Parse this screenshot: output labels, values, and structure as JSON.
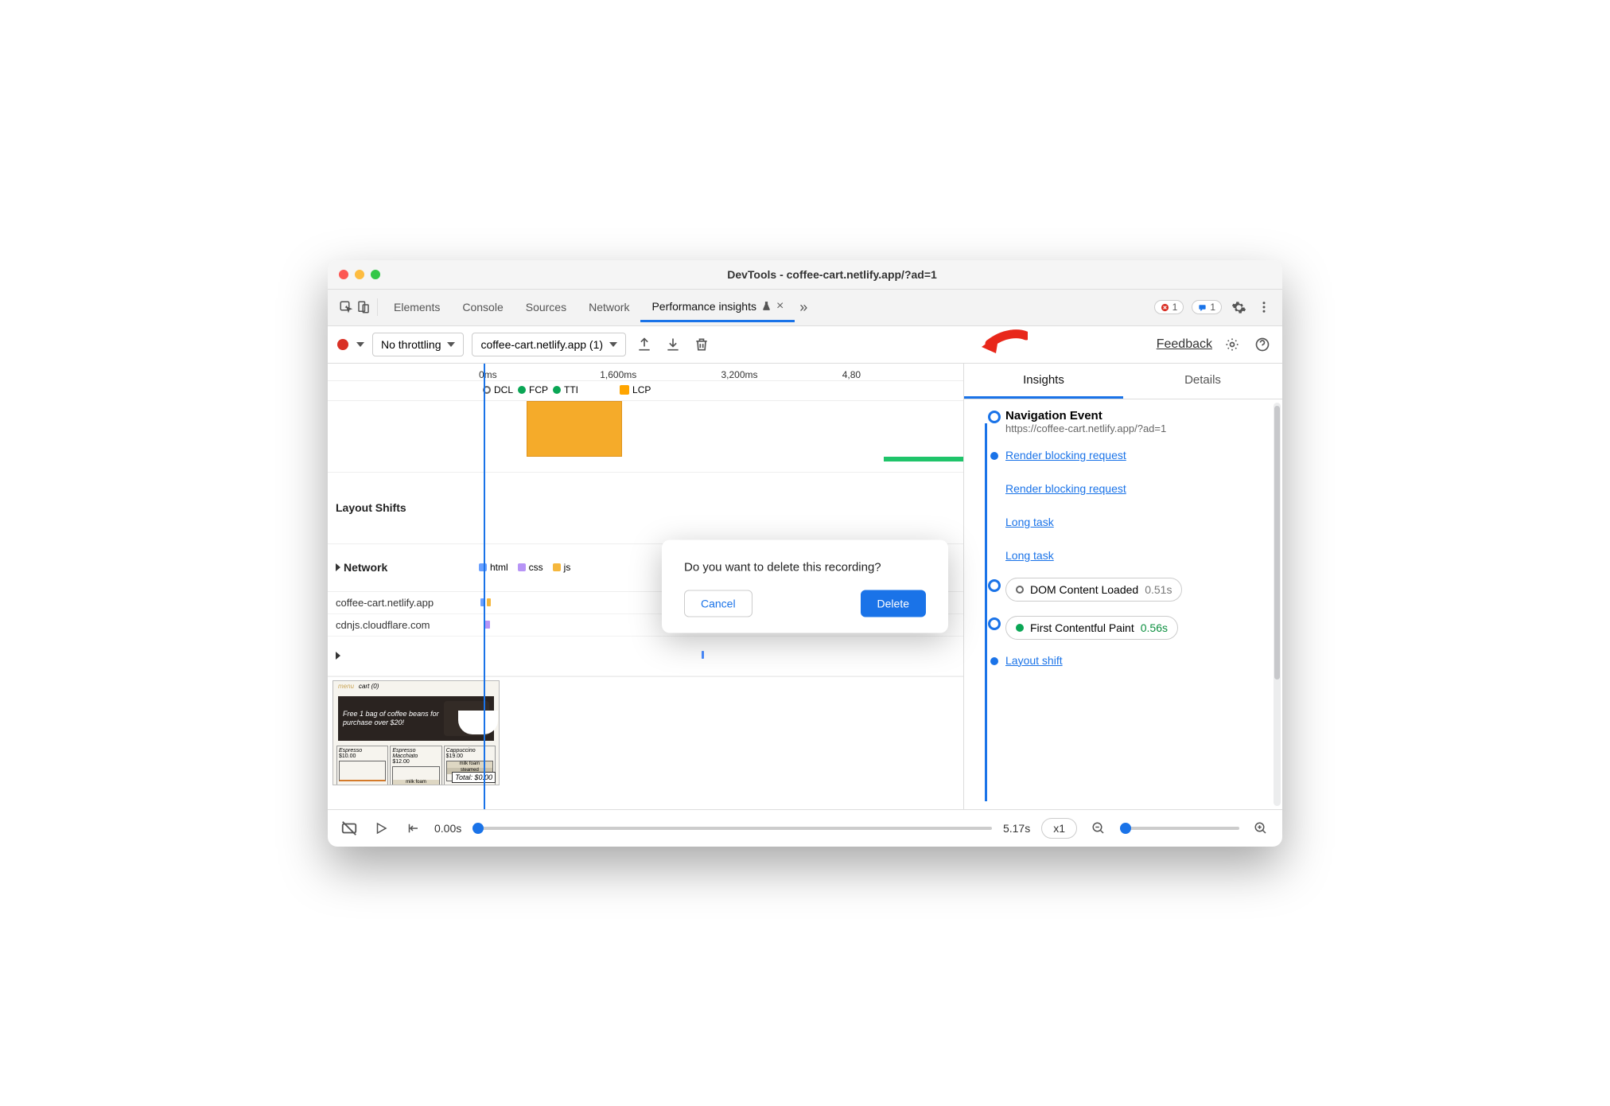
{
  "window": {
    "title": "DevTools - coffee-cart.netlify.app/?ad=1"
  },
  "tabs": {
    "items": [
      "Elements",
      "Console",
      "Sources",
      "Network",
      "Performance insights"
    ],
    "active_index": 4,
    "errors_count": "1",
    "messages_count": "1"
  },
  "toolbar": {
    "throttling": "No throttling",
    "recording_name": "coffee-cart.netlify.app (1)",
    "feedback": "Feedback"
  },
  "timeline": {
    "ticks": [
      "0ms",
      "1,600ms",
      "3,200ms",
      "4,80"
    ],
    "markers": [
      "DCL",
      "FCP",
      "TTI",
      "LCP"
    ]
  },
  "tracks": {
    "layout_shifts": "Layout Shifts",
    "network": "Network",
    "net_legend": [
      "html",
      "css",
      "js"
    ],
    "hosts": [
      "coffee-cart.netlify.app",
      "cdnjs.cloudflare.com"
    ]
  },
  "screenshot": {
    "menu": "menu",
    "cart": "cart (0)",
    "banner": "Free 1 bag of coffee beans for purchase over $20!",
    "products": [
      {
        "name": "Espresso",
        "price": "$10.00"
      },
      {
        "name": "Espresso Macchiato",
        "price": "$12.00"
      },
      {
        "name": "Cappuccino",
        "price": "$19.00"
      }
    ],
    "foam": "milk foam",
    "steamed": "steamed",
    "total": "Total: $0.00"
  },
  "side": {
    "tabs": [
      "Insights",
      "Details"
    ],
    "nav_title": "Navigation Event",
    "nav_url": "https://coffee-cart.netlify.app/?ad=1",
    "links": [
      "Render blocking request",
      "Render blocking request",
      "Long task",
      "Long task"
    ],
    "dcl_label": "DOM Content Loaded",
    "dcl_time": "0.51s",
    "fcp_label": "First Contentful Paint",
    "fcp_time": "0.56s",
    "layout_shift": "Layout shift"
  },
  "playback": {
    "start": "0.00s",
    "end": "5.17s",
    "speed": "x1"
  },
  "modal": {
    "text": "Do you want to delete this recording?",
    "cancel": "Cancel",
    "delete": "Delete"
  }
}
